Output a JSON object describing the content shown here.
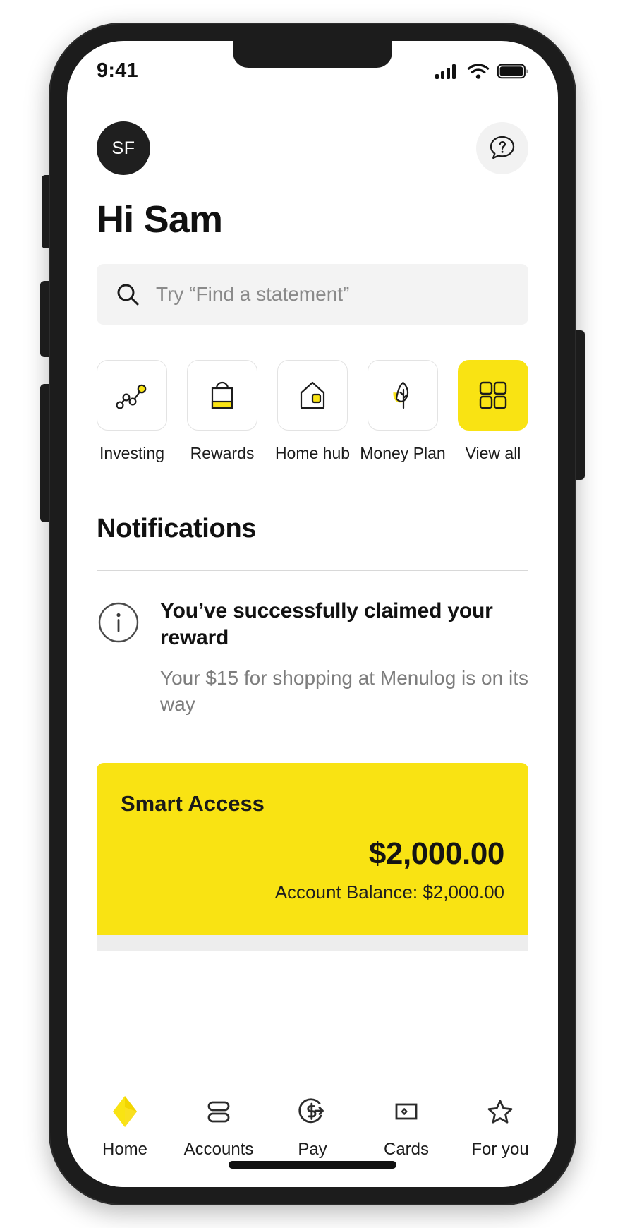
{
  "status_bar": {
    "time": "9:41",
    "icons": [
      "cellular-signal-icon",
      "wifi-icon",
      "battery-icon"
    ]
  },
  "header": {
    "avatar_initials": "SF",
    "help_icon": "help-chat-bubble-icon",
    "greeting": "Hi Sam"
  },
  "search": {
    "icon": "search-icon",
    "placeholder": "Try “Find a statement”",
    "value": ""
  },
  "quick_actions": [
    {
      "label": "Investing",
      "icon": "line-chart-icon",
      "active": false
    },
    {
      "label": "Rewards",
      "icon": "shopping-bag-icon",
      "active": false
    },
    {
      "label": "Home hub",
      "icon": "house-icon",
      "active": false
    },
    {
      "label": "Money Plan",
      "icon": "leaf-icon",
      "active": false
    },
    {
      "label": "View all",
      "icon": "grid-icon",
      "active": true
    }
  ],
  "notifications": {
    "heading": "Notifications",
    "items": [
      {
        "icon": "info-circle-icon",
        "title": "You’ve successfully claimed your reward",
        "subtitle": "Your $15 for shopping at Menulog is on its way"
      }
    ]
  },
  "account_card": {
    "name": "Smart Access",
    "amount": "$2,000.00",
    "balance_line": "Account Balance: $2,000.00"
  },
  "tab_bar": [
    {
      "label": "Home",
      "icon": "diamond-logo-icon",
      "active": true
    },
    {
      "label": "Accounts",
      "icon": "stacked-bars-icon",
      "active": false
    },
    {
      "label": "Pay",
      "icon": "dollar-arrow-icon",
      "active": false
    },
    {
      "label": "Cards",
      "icon": "card-icon",
      "active": false
    },
    {
      "label": "For you",
      "icon": "star-icon",
      "active": false
    }
  ],
  "colors": {
    "brand_yellow": "#f9e313",
    "text_primary": "#111111",
    "text_muted": "#7d7d7d",
    "surface_grey": "#f3f3f3"
  }
}
